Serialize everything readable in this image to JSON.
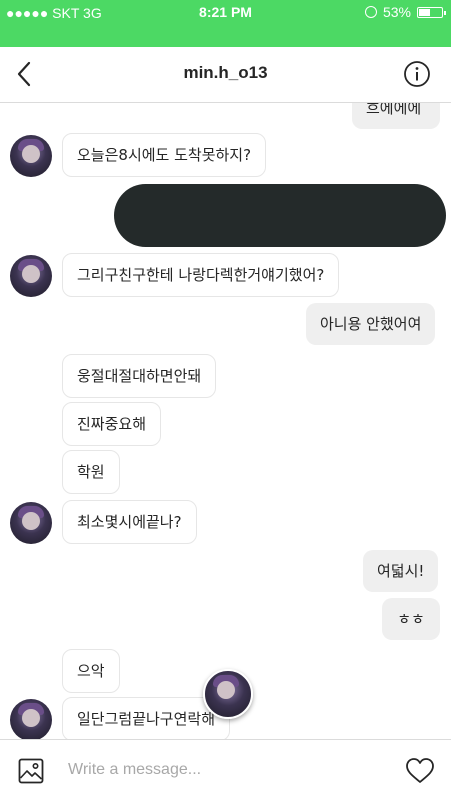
{
  "status_bar": {
    "carrier": "●●●●● SKT  3G",
    "time": "8:21 PM",
    "battery": "53%",
    "battery_level": 0.53
  },
  "header": {
    "title": "min.h_o13"
  },
  "messages": [
    {
      "dir": "out",
      "text": "흐에에에"
    },
    {
      "dir": "in",
      "text": "오늘은8시에도 도착못하지?"
    },
    {
      "dir": "out",
      "text": "",
      "redacted": true
    },
    {
      "dir": "in",
      "text": "그리구친구한테 나랑다렉한거얘기했어?"
    },
    {
      "dir": "out",
      "text": "아니용 안했어여"
    },
    {
      "dir": "in",
      "text": "웅절대절대하면안돼"
    },
    {
      "dir": "in",
      "text": "진짜중요해"
    },
    {
      "dir": "in",
      "text": "학원"
    },
    {
      "dir": "in",
      "text": "최소몇시에끝나?"
    },
    {
      "dir": "out",
      "text": "여덟시!"
    },
    {
      "dir": "out",
      "text": "ㅎㅎ"
    },
    {
      "dir": "in",
      "text": "으악"
    },
    {
      "dir": "in",
      "text": "일단그럼끝나구연락해"
    }
  ],
  "composer": {
    "placeholder": "Write a message..."
  },
  "colors": {
    "status_green": "#4cd964",
    "outgoing_bubble": "#efefef",
    "redaction": "#242a2a"
  },
  "icons": [
    "back-icon",
    "info-icon",
    "gallery-icon",
    "heart-icon",
    "battery-icon",
    "orientation-lock-icon"
  ]
}
